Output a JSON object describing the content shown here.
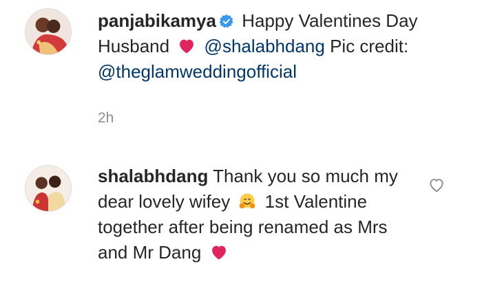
{
  "caption": {
    "username": "panjabikamya",
    "text_1": "Happy Valentines Day Husband",
    "mention_1": "@shalabhdang",
    "text_2": "Pic credit:",
    "mention_2": "@theglamweddingofficial",
    "emoji": "red-heart",
    "time": "2h"
  },
  "reply": {
    "username": "shalabhdang",
    "text_1": "Thank you so much my dear lovely wifey",
    "text_2": "1st Valentine together after being renamed as Mrs and Mr Dang",
    "emoji_1": "hugging-face",
    "emoji_2": "red-heart"
  },
  "colors": {
    "text": "#262626",
    "mention": "#00376b",
    "muted": "#8e8e8e",
    "verified": "#3897f0",
    "heart": "#e0245e"
  }
}
